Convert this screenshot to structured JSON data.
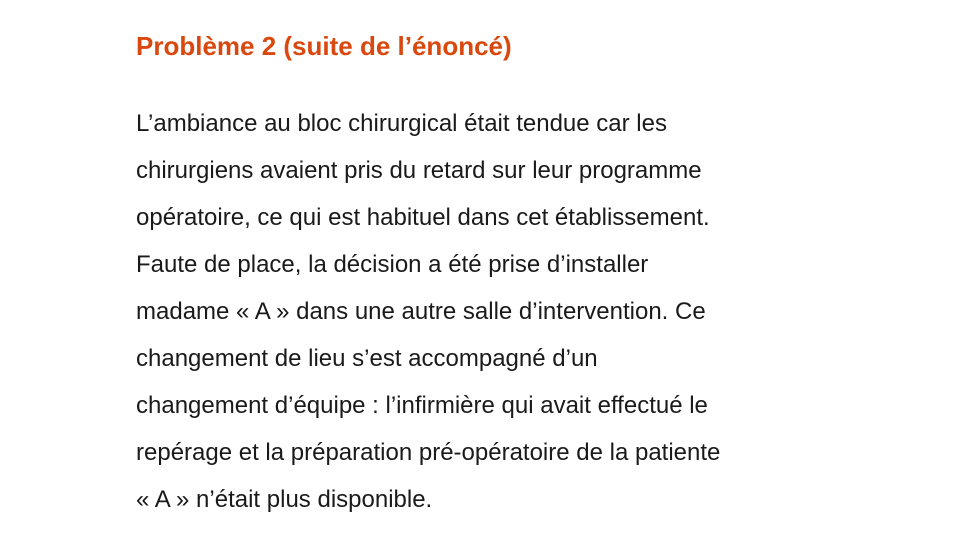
{
  "slide": {
    "title": "Problème 2 (suite de l’énoncé)",
    "title_color": "#d9480f",
    "text_color": "#1a1a1a",
    "lines": [
      "L’ambiance au bloc chirurgical était tendue car les",
      "chirurgiens avaient pris du retard sur leur programme",
      "opératoire, ce qui est habituel dans cet établissement.",
      "Faute de place, la décision a été prise d’installer",
      "madame « A » dans une autre salle d’intervention. Ce",
      "changement de lieu s’est accompagné d’un",
      "changement d’équipe : l’infirmière qui avait effectué le",
      "repérage et la préparation pré-opératoire de la patiente",
      "« A » n’était plus disponible."
    ]
  }
}
